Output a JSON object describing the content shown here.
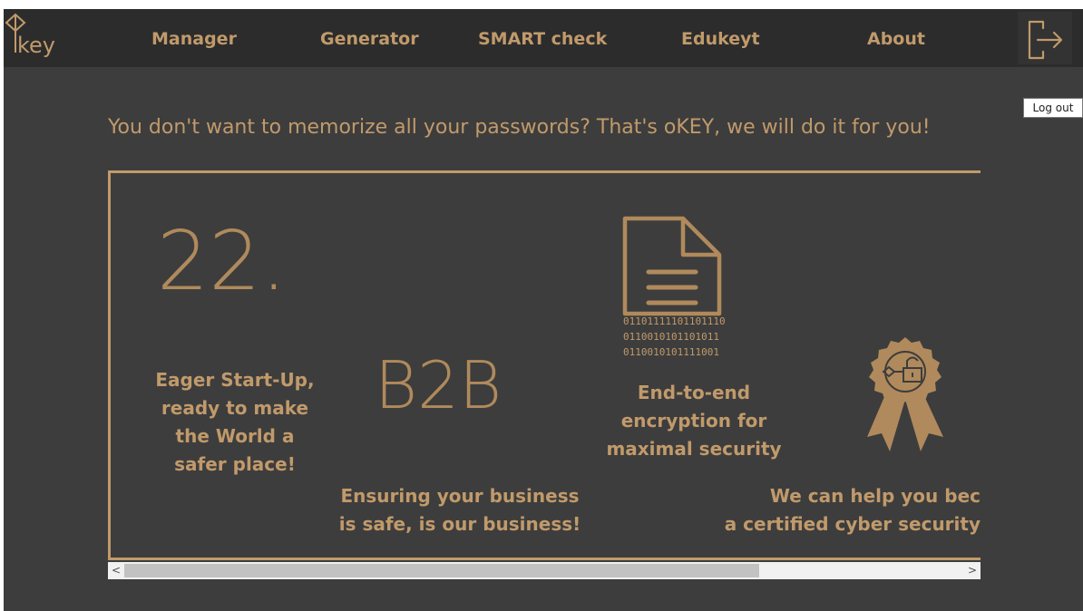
{
  "nav": {
    "logo_text": "key",
    "items": [
      {
        "label": "Manager"
      },
      {
        "label": "Generator"
      },
      {
        "label": "SMART check"
      },
      {
        "label": "Edukeyt"
      },
      {
        "label": "About"
      }
    ],
    "logout_tooltip": "Log out"
  },
  "hero": {
    "slogan": "You don't want to memorize all your passwords? That's oKEY, we will do it for you!"
  },
  "features": {
    "startup": {
      "number": "22.",
      "lines": [
        "Eager Start-Up,",
        "ready to make",
        "the World a",
        "safer place!"
      ]
    },
    "b2b": {
      "heading": "B2B",
      "lines": [
        "Ensuring your business",
        "is safe, is our business!"
      ]
    },
    "encryption": {
      "binary": [
        "01101111101101110",
        "0110010101101011",
        "0110010101111001"
      ],
      "lines": [
        "End-to-end",
        "encryption for",
        "maximal security"
      ]
    },
    "certified": {
      "lines": [
        "We can help you bec",
        "a certified cyber security"
      ]
    }
  },
  "colors": {
    "accent": "#c19a6b",
    "background": "#3d3d3d",
    "navbar": "#2c2c2c"
  },
  "icons": [
    "key-logo",
    "logout-icon",
    "document-icon",
    "award-ribbon-icon",
    "unlock-icon",
    "chevron-left-icon",
    "chevron-right-icon"
  ]
}
